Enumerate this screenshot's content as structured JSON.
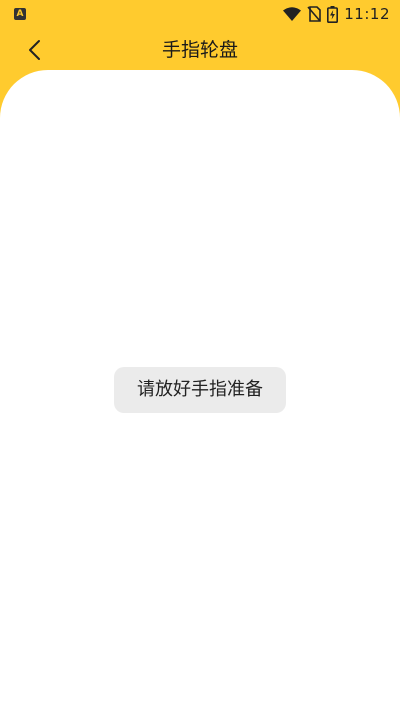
{
  "status_bar": {
    "badge_letter": "A",
    "time": "11:12",
    "icons": [
      "wifi-icon",
      "no-sim-icon",
      "battery-charging-icon"
    ]
  },
  "header": {
    "title": "手指轮盘",
    "back_icon": "chevron-left-icon"
  },
  "main": {
    "toast_message": "请放好手指准备"
  },
  "colors": {
    "accent": "#FFCB2E",
    "background": "#FFFFFF",
    "toast_bg": "#EBEBEB"
  }
}
